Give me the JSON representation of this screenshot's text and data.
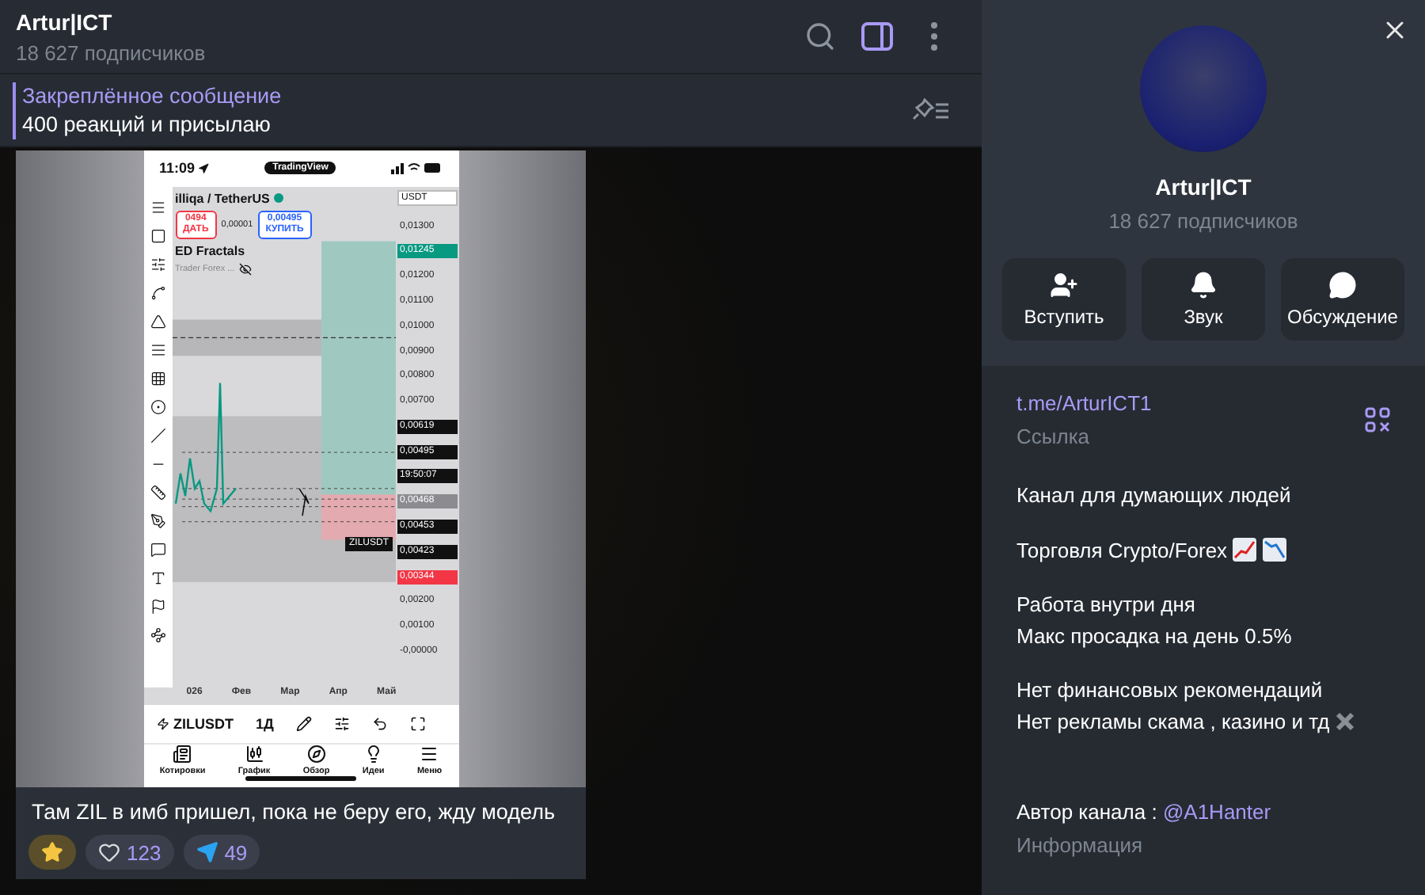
{
  "header": {
    "title": "Artur|ICT",
    "subtitle": "18 627 подписчиков",
    "sidebar_open": true
  },
  "pinned": {
    "label": "Закреплённое сообщение",
    "text": "400 реакций и присылаю"
  },
  "message": {
    "phone": {
      "time": "11:09",
      "app_badge": "TradingView",
      "symbol": "illiqa / TetherUS",
      "currency": "USDT",
      "sell_price": "0494",
      "sell_label": "ДАТЬ",
      "spread": "0,00001",
      "buy_price": "0,00495",
      "buy_label": "КУПИТЬ",
      "indicator": "ED Fractals",
      "indicator_2": "Trader Forex ...",
      "price_labels": [
        {
          "text": "0,01300",
          "kind": "plain"
        },
        {
          "text": "0,01245",
          "kind": "green"
        },
        {
          "text": "0,01200",
          "kind": "plain"
        },
        {
          "text": "0,01100",
          "kind": "plain"
        },
        {
          "text": "0,01000",
          "kind": "plain"
        },
        {
          "text": "0,00900",
          "kind": "plain"
        },
        {
          "text": "0,00800",
          "kind": "plain"
        },
        {
          "text": "0,00700",
          "kind": "plain"
        },
        {
          "text": "0,00619",
          "kind": "black"
        },
        {
          "text": "0,00495",
          "kind": "black"
        },
        {
          "text": "19:50:07",
          "kind": "black"
        },
        {
          "text": "0,00468",
          "kind": "grey"
        },
        {
          "text": "0,00453",
          "kind": "black"
        },
        {
          "text": "0,00423",
          "kind": "black"
        },
        {
          "text": "0,00344",
          "kind": "red"
        },
        {
          "text": "0,00200",
          "kind": "plain"
        },
        {
          "text": "0,00100",
          "kind": "plain"
        },
        {
          "text": "-0,00000",
          "kind": "plain"
        }
      ],
      "price_tag": "ZILUSDT",
      "months": [
        "026",
        "Фев",
        "Мар",
        "Апр",
        "Май"
      ],
      "ticker": "ZILUSDT",
      "interval": "1Д",
      "nav": [
        {
          "label": "Котировки",
          "kind": "quotes"
        },
        {
          "label": "График",
          "kind": "chart"
        },
        {
          "label": "Обзор",
          "kind": "explore"
        },
        {
          "label": "Идеи",
          "kind": "ideas"
        },
        {
          "label": "Меню",
          "kind": "menu"
        }
      ]
    },
    "caption": "Там ZIL в имб пришел, пока не беру его, жду модель",
    "reactions": [
      {
        "kind": "star",
        "selected": true
      },
      {
        "kind": "heart",
        "count": "123",
        "selected": false
      },
      {
        "kind": "telegram",
        "count": "49",
        "selected": false
      }
    ]
  },
  "profile": {
    "name": "Artur|ICT",
    "subscribers": "18 627 подписчиков",
    "actions": [
      {
        "label": "Вступить",
        "kind": "join"
      },
      {
        "label": "Звук",
        "kind": "sound"
      },
      {
        "label": "Обсуждение",
        "kind": "discussion"
      }
    ],
    "link": "t.me/ArturICT1",
    "link_label": "Ссылка",
    "description": [
      [
        "Канал для думающих людей"
      ],
      [
        "Торговля Crypto/Forex"
      ],
      [
        "Работа внутри дня",
        "Макс просадка на день 0.5%"
      ],
      [
        "Нет финансовых рекомендаций",
        "Нет рекламы скама , казино и тд"
      ]
    ],
    "author_label": "Автор канала :",
    "author_handle": "@A1Hanter",
    "info_label": "Информация"
  }
}
